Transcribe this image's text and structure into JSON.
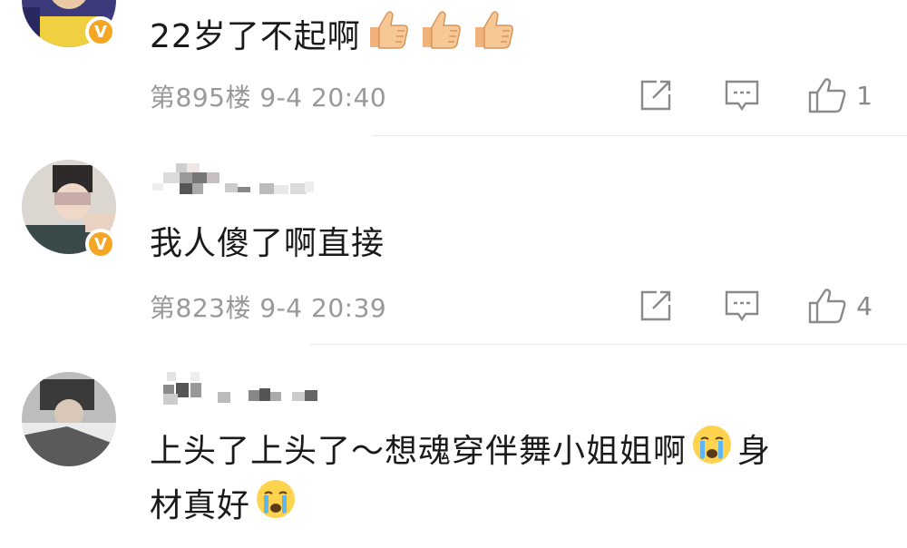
{
  "comments": [
    {
      "text": "22岁了不起啊",
      "floor": "第895楼",
      "date": "9-4",
      "time": "20:40",
      "likes": "1",
      "verified_badge": "V",
      "emoji": [
        "thumbs-up-icon",
        "thumbs-up-icon",
        "thumbs-up-icon"
      ]
    },
    {
      "text": "我人傻了啊直接",
      "floor": "第823楼",
      "date": "9-4",
      "time": "20:39",
      "likes": "4",
      "verified_badge": "V"
    },
    {
      "text_part1": "上头了上头了～想魂穿伴舞小姐姐啊",
      "text_part2": "身",
      "text_part3": "材真好",
      "emoji": [
        "crying-face-icon",
        "crying-face-icon"
      ]
    }
  ],
  "colors": {
    "badge": "#f5a623",
    "meta_text": "#999999",
    "divider": "#e6e6e6"
  }
}
